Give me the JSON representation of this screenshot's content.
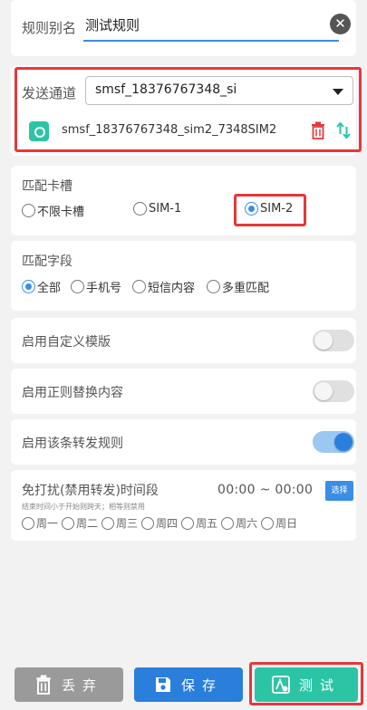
{
  "rule_name": {
    "label": "规则别名",
    "value": "测试规则"
  },
  "channel": {
    "label": "发送通道",
    "selected": "smsf_18376767348_si",
    "entry_text": "smsf_18376767348_sim2_7348SIM2"
  },
  "sim_slot": {
    "label": "匹配卡槽",
    "options": [
      "不限卡槽",
      "SIM-1",
      "SIM-2"
    ],
    "selected": "SIM-2"
  },
  "match_field": {
    "label": "匹配字段",
    "options": [
      "全部",
      "手机号",
      "短信内容",
      "多重匹配"
    ],
    "selected": "全部"
  },
  "toggles": {
    "custom_template": {
      "label": "启用自定义模版",
      "on": false
    },
    "regex_replace": {
      "label": "启用正则替换内容",
      "on": false
    },
    "enable_rule": {
      "label": "启用该条转发规则",
      "on": true
    }
  },
  "dnd": {
    "title": "免打扰(禁用转发)时间段",
    "note": "结束时间小于开始则跨天；相等则禁用",
    "time_range": "00:00 ~ 00:00",
    "choose_label": "选择",
    "weekdays": [
      "周一",
      "周二",
      "周三",
      "周四",
      "周五",
      "周六",
      "周日"
    ]
  },
  "buttons": {
    "discard": "丢弃",
    "save": "保存",
    "test": "测试"
  },
  "colors": {
    "accent": "#3a8ee6",
    "teal": "#2bc5a6",
    "highlight": "#e5383b",
    "gray": "#9a9a9a"
  }
}
